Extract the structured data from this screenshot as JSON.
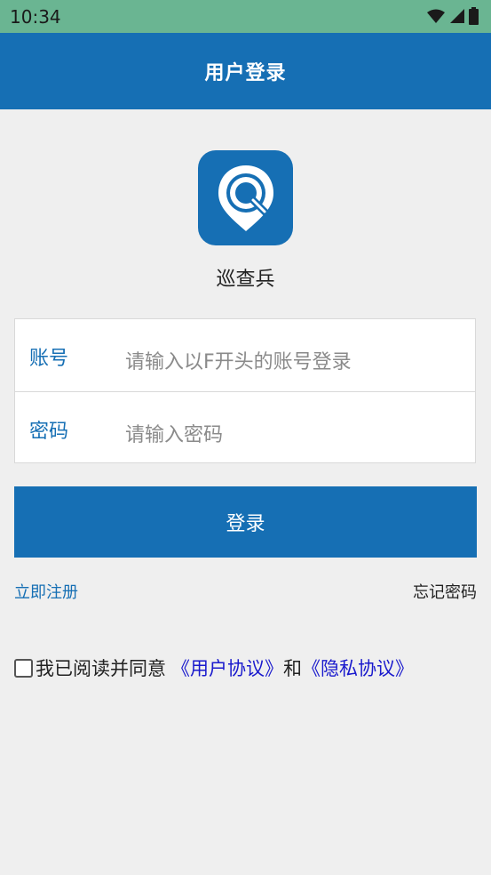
{
  "status_bar": {
    "time": "10:34",
    "icons": [
      "wifi-icon",
      "signal-icon",
      "battery-icon"
    ]
  },
  "app_bar": {
    "title": "用户登录"
  },
  "app": {
    "name": "巡查兵",
    "logo_icon": "location-search-icon"
  },
  "form": {
    "account_label": "账号",
    "account_placeholder": "请输入以F开头的账号登录",
    "password_label": "密码",
    "password_placeholder": "请输入密码"
  },
  "actions": {
    "login_label": "登录",
    "register_label": "立即注册",
    "forgot_label": "忘记密码"
  },
  "agreement": {
    "checked": false,
    "prefix": "我已阅读并同意",
    "user_agreement": "《用户协议》",
    "and": "和",
    "privacy_policy": "《隐私协议》"
  },
  "colors": {
    "primary": "#166fb4",
    "status_bar": "#6ab592",
    "background": "#efefef",
    "link": "#1a1acd"
  }
}
